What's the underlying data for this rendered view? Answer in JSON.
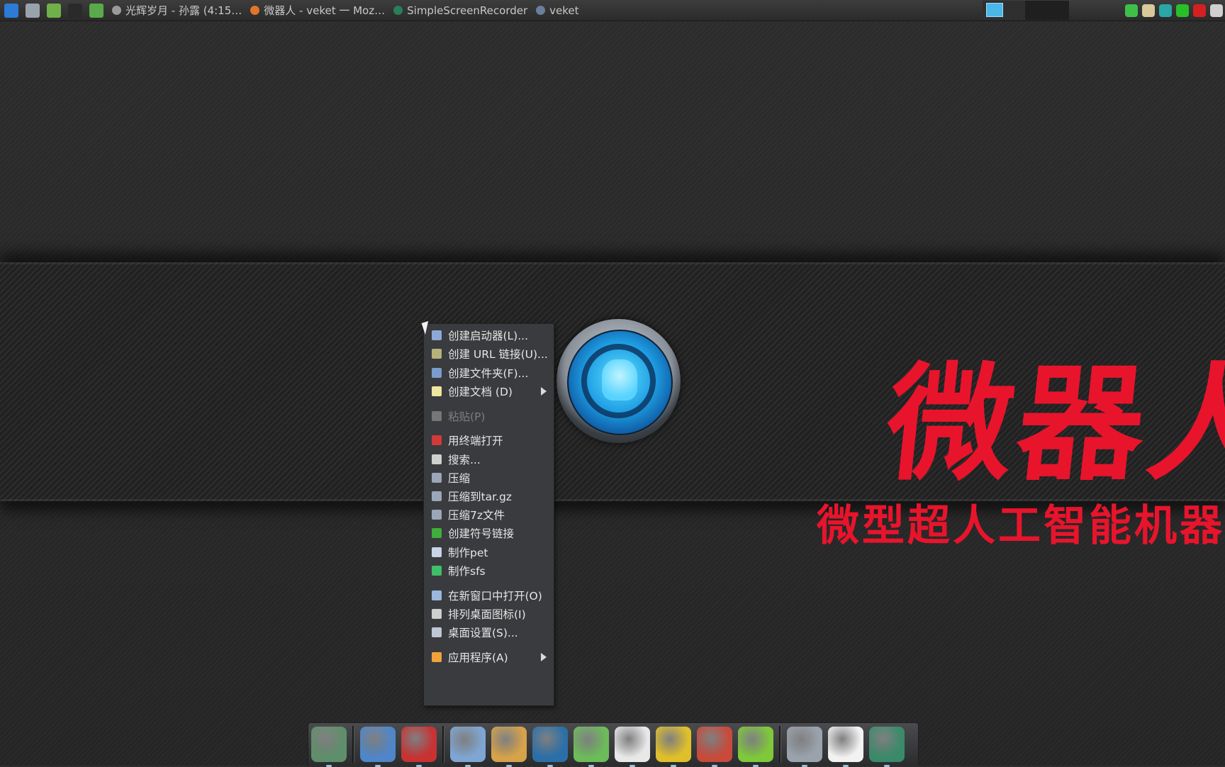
{
  "taskbar": {
    "launchers": [
      {
        "icon": "system-monitor-icon",
        "color": "#2c7bd6"
      },
      {
        "icon": "settings-gear-icon",
        "color": "#9aa3ad"
      },
      {
        "icon": "media-play-icon",
        "color": "#6fb04a"
      },
      {
        "icon": "terminal-icon",
        "color": "#2a2a2a"
      },
      {
        "icon": "globe-icon",
        "color": "#5aa94a"
      }
    ],
    "tasks": [
      {
        "label": "光辉岁月 - 孙露 (4:15…",
        "icon": "music-player-icon",
        "color": "#9a9a9a"
      },
      {
        "label": "微器人 - veket 一 Moz…",
        "icon": "firefox-icon",
        "color": "#e0762a"
      },
      {
        "label": "SimpleScreenRecorder",
        "icon": "screen-recorder-icon",
        "color": "#2c7d5a"
      },
      {
        "label": "veket",
        "icon": "folder-icon",
        "color": "#6a7f9a"
      }
    ],
    "tray": [
      {
        "icon": "shield-icon",
        "color": "#3fbf4a"
      },
      {
        "icon": "clipboard-icon",
        "color": "#d8c89a"
      },
      {
        "icon": "network-icon",
        "color": "#2aa6a6"
      },
      {
        "icon": "battery-icon",
        "color": "#28c028"
      },
      {
        "icon": "record-icon",
        "color": "#d42020"
      },
      {
        "icon": "keyboard-icon",
        "color": "#cfcfcf"
      }
    ]
  },
  "wallpaper": {
    "title": "微器人",
    "subtitle": "微型超人工智能机器"
  },
  "context_menu": {
    "items": [
      {
        "label": "创建启动器(L)...",
        "icon": "launcher-icon",
        "color": "#8fa9d6",
        "enabled": true,
        "submenu": false
      },
      {
        "label": "创建 URL 链接(U)...",
        "icon": "url-link-icon",
        "color": "#b7b27a",
        "enabled": true,
        "submenu": false
      },
      {
        "label": "创建文件夹(F)...",
        "icon": "new-folder-icon",
        "color": "#7c9ccc",
        "enabled": true,
        "submenu": false
      },
      {
        "label": "创建文档 (D)",
        "icon": "new-document-icon",
        "color": "#efe6a0",
        "enabled": true,
        "submenu": true
      },
      {
        "label": "粘贴(P)",
        "icon": "paste-icon",
        "color": "#777777",
        "enabled": false,
        "submenu": false
      },
      {
        "label": "用终端打开",
        "icon": "terminal-icon",
        "color": "#d23a3a",
        "enabled": true,
        "submenu": false
      },
      {
        "label": "搜索...",
        "icon": "search-icon",
        "color": "#d0d0d0",
        "enabled": true,
        "submenu": false
      },
      {
        "label": "压缩",
        "icon": "archive-icon",
        "color": "#9aa7b8",
        "enabled": true,
        "submenu": false
      },
      {
        "label": "压缩到tar.gz",
        "icon": "archive-icon",
        "color": "#9aa7b8",
        "enabled": true,
        "submenu": false
      },
      {
        "label": "压缩7z文件",
        "icon": "archive-icon",
        "color": "#9aa7b8",
        "enabled": true,
        "submenu": false
      },
      {
        "label": "创建符号链接",
        "icon": "symlink-icon",
        "color": "#3fae3a",
        "enabled": true,
        "submenu": false
      },
      {
        "label": "制作pet",
        "icon": "computer-icon",
        "color": "#c9d4e6",
        "enabled": true,
        "submenu": false
      },
      {
        "label": "制作sfs",
        "icon": "recycle-icon",
        "color": "#3fbf6a",
        "enabled": true,
        "submenu": false
      },
      {
        "label": "在新窗口中打开(O)",
        "icon": "window-icon",
        "color": "#9bb7df",
        "enabled": true,
        "submenu": false
      },
      {
        "label": "排列桌面图标(I)",
        "icon": "sort-icon",
        "color": "#cfcfcf",
        "enabled": true,
        "submenu": false
      },
      {
        "label": "桌面设置(S)...",
        "icon": "desktop-settings-icon",
        "color": "#bfc7d4",
        "enabled": true,
        "submenu": false
      },
      {
        "label": "应用程序(A)",
        "icon": "applications-icon",
        "color": "#f0a33a",
        "enabled": true,
        "submenu": true
      }
    ]
  },
  "dock": {
    "groups": [
      [
        {
          "icon": "chameleon-icon",
          "color": "#5f8f6a"
        }
      ],
      [
        {
          "icon": "monitor-icon",
          "color": "#4f86c8"
        },
        {
          "icon": "hedgehog-icon",
          "color": "#c83232"
        }
      ],
      [
        {
          "icon": "text-editor-icon",
          "color": "#7fa6d2"
        },
        {
          "icon": "paint-palette-icon",
          "color": "#d6a24a"
        },
        {
          "icon": "media-dial-icon",
          "color": "#2b6fa8"
        },
        {
          "icon": "users-globe-icon",
          "color": "#6cbc5a"
        },
        {
          "icon": "penguin-icon",
          "color": "#e8e8e8"
        },
        {
          "icon": "exit-door-icon",
          "color": "#e0c02a"
        },
        {
          "icon": "chart-icon",
          "color": "#c84a3a"
        },
        {
          "icon": "help-question-icon",
          "color": "#7fc83a"
        }
      ],
      [
        {
          "icon": "drive-icon",
          "color": "#9aa3ad"
        },
        {
          "icon": "sun-brightness-icon",
          "color": "#f2f2f2"
        },
        {
          "icon": "camera-lens-icon",
          "color": "#3a8a6a"
        }
      ]
    ]
  }
}
